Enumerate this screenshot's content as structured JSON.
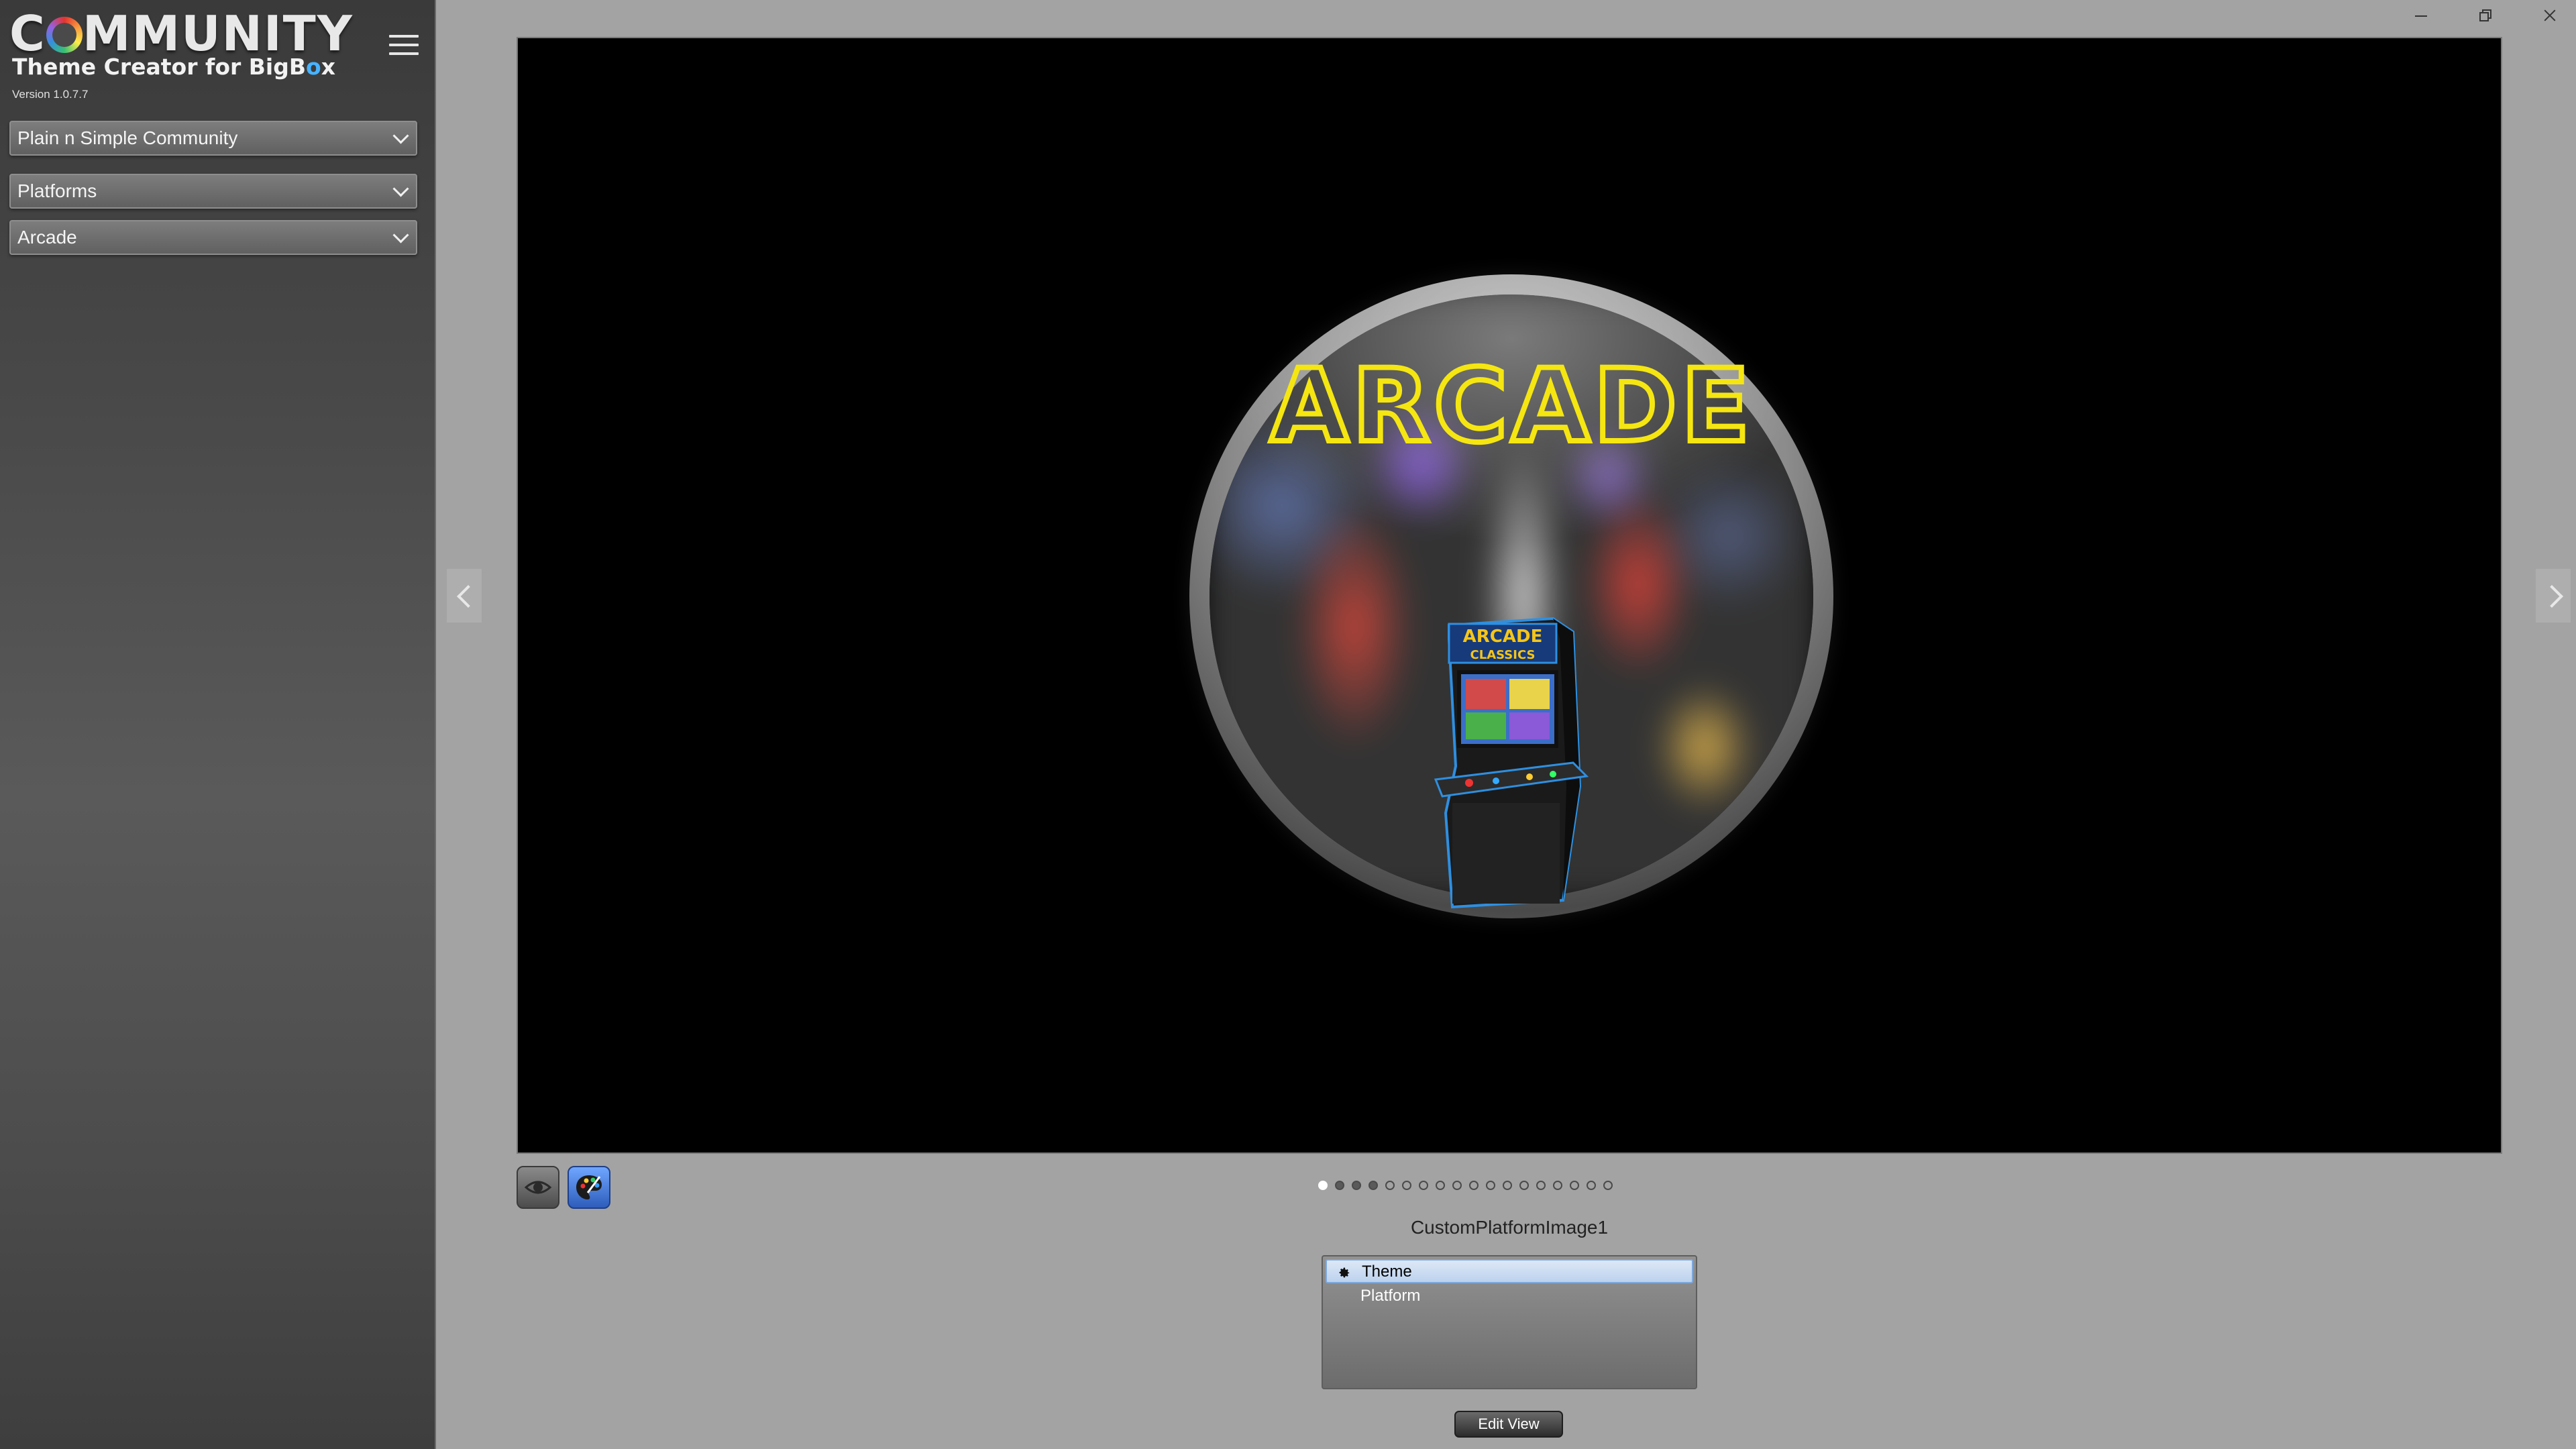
{
  "app": {
    "logo_prefix": "C",
    "logo_suffix": "MMUNITY",
    "subtitle_prefix": "Theme Creator for BigB",
    "subtitle_o": "o",
    "subtitle_suffix": "x",
    "version": "Version 1.0.7.7"
  },
  "sidebar": {
    "theme_dropdown": "Plain n Simple Community",
    "view_dropdown": "Platforms",
    "platform_dropdown": "Arcade"
  },
  "preview": {
    "logo_text": "ARCADE",
    "cabinet_marquee_line1": "ARCADE",
    "cabinet_marquee_line2": "CLASSICS"
  },
  "pager": {
    "total": 18,
    "active_index": 0,
    "filled_indices": [
      1,
      2,
      3
    ]
  },
  "view_name": "CustomPlatformImage1",
  "layers": {
    "items": [
      {
        "label": "Theme",
        "icon": "gear-icon",
        "selected": true
      },
      {
        "label": "Platform",
        "icon": "",
        "selected": false
      }
    ]
  },
  "edit_button": "Edit View",
  "colors": {
    "accent_blue": "#3a7bd5",
    "logo_yellow": "#f5e611",
    "selection": "#bcd2ee"
  }
}
